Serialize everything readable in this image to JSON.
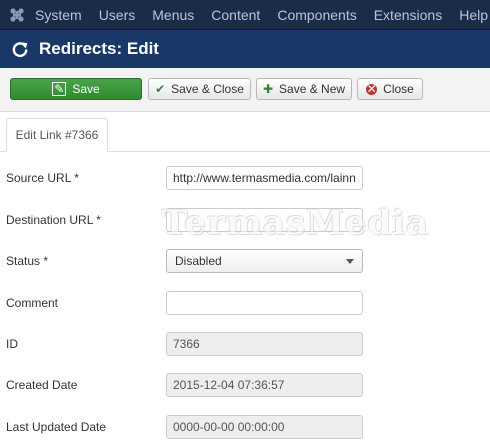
{
  "top_menu": {
    "items": [
      "System",
      "Users",
      "Menus",
      "Content",
      "Components",
      "Extensions",
      "Help"
    ]
  },
  "title_bar": {
    "title": "Redirects: Edit",
    "icon": "refresh-icon"
  },
  "toolbar": {
    "save_label": "Save",
    "save_close_label": "Save & Close",
    "save_new_label": "Save & New",
    "close_label": "Close"
  },
  "tabs": [
    {
      "label": "Edit Link #7366",
      "active": true
    }
  ],
  "form": {
    "source_url": {
      "label": "Source URL *",
      "value": "http://www.termasmedia.com/lainnya/"
    },
    "destination_url": {
      "label": "Destination URL *",
      "value": ""
    },
    "status": {
      "label": "Status *",
      "value": "Disabled"
    },
    "comment": {
      "label": "Comment",
      "value": ""
    },
    "id": {
      "label": "ID",
      "value": "7366"
    },
    "created_date": {
      "label": "Created Date",
      "value": "2015-12-04 07:36:57"
    },
    "last_updated_date": {
      "label": "Last Updated Date",
      "value": "0000-00-00 00:00:00"
    }
  },
  "watermark": "TermasMedia",
  "colors": {
    "topbar_bg": "#1b2b4a",
    "titlebar_bg": "#1a3867",
    "save_green": "#3a953a",
    "close_red": "#bd362f"
  }
}
